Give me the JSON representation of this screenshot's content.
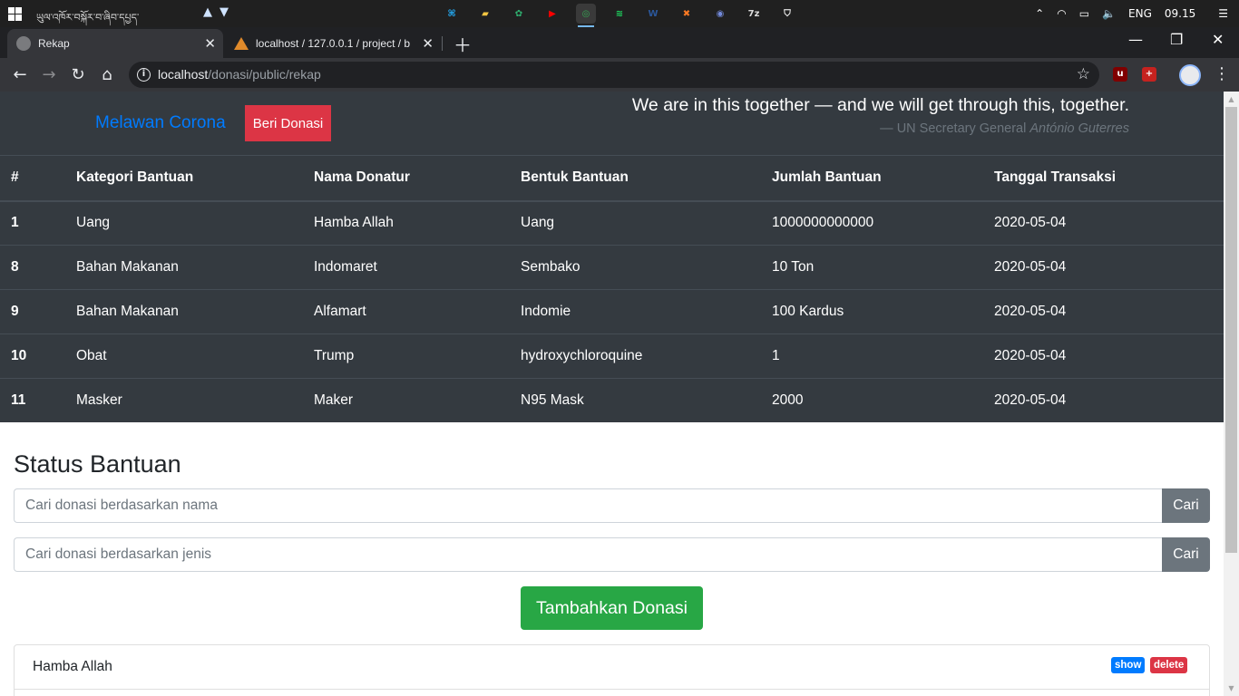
{
  "taskbar": {
    "task_name": "ཡུལ་འཁོར་བསྐོར་བ་ཞིབ་དཔྱད་",
    "apps": [
      {
        "name": "vscode-icon",
        "glyph": "⌘",
        "color": "#23a9f2",
        "active": false
      },
      {
        "name": "file-explorer-icon",
        "glyph": "▰",
        "color": "#f3c642",
        "active": false
      },
      {
        "name": "app-green-icon",
        "glyph": "✿",
        "color": "#2fb170",
        "active": false
      },
      {
        "name": "youtube-icon",
        "glyph": "▶",
        "color": "#ff0000",
        "active": false
      },
      {
        "name": "chrome-icon",
        "glyph": "◎",
        "color": "#34a853",
        "active": true
      },
      {
        "name": "spotify-icon",
        "glyph": "≋",
        "color": "#1ed760",
        "active": false
      },
      {
        "name": "word-icon",
        "glyph": "W",
        "color": "#2b579a",
        "active": false
      },
      {
        "name": "xampp-icon",
        "glyph": "✖",
        "color": "#fb7a24",
        "active": false
      },
      {
        "name": "discord-icon",
        "glyph": "◉",
        "color": "#7289da",
        "active": false
      },
      {
        "name": "7zip-icon",
        "glyph": "7z",
        "color": "#dddddd",
        "active": false
      },
      {
        "name": "shield-app-icon",
        "glyph": "⛉",
        "color": "#ffffff",
        "active": false
      }
    ],
    "tray": {
      "language": "ENG",
      "time": "09.15"
    }
  },
  "browser": {
    "tabs": [
      {
        "title": "Rekap",
        "active": true
      },
      {
        "title": "localhost / 127.0.0.1 / project / b",
        "active": false
      }
    ],
    "url_host": "localhost",
    "url_path": "/donasi/public/rekap"
  },
  "header": {
    "brand": "Melawan Corona",
    "donate_label": "Beri Donasi",
    "quote_text": "We are in this together — and we will get through this, together.",
    "quote_source_prefix": "— UN Secretary General ",
    "quote_source_name": "António Guterres"
  },
  "table": {
    "columns": [
      "#",
      "Kategori Bantuan",
      "Nama Donatur",
      "Bentuk Bantuan",
      "Jumlah Bantuan",
      "Tanggal Transaksi"
    ],
    "rows": [
      [
        "1",
        "Uang",
        "Hamba Allah",
        "Uang",
        "1000000000000",
        "2020-05-04"
      ],
      [
        "8",
        "Bahan Makanan",
        "Indomaret",
        "Sembako",
        "10 Ton",
        "2020-05-04"
      ],
      [
        "9",
        "Bahan Makanan",
        "Alfamart",
        "Indomie",
        "100 Kardus",
        "2020-05-04"
      ],
      [
        "10",
        "Obat",
        "Trump",
        "hydroxychloroquine",
        "1",
        "2020-05-04"
      ],
      [
        "11",
        "Masker",
        "Maker",
        "N95 Mask",
        "2000",
        "2020-05-04"
      ]
    ]
  },
  "status": {
    "title": "Status Bantuan",
    "search_name_placeholder": "Cari donasi berdasarkan nama",
    "search_type_placeholder": "Cari donasi berdasarkan jenis",
    "search_button": "Cari",
    "add_button": "Tambahkan Donasi",
    "items": [
      {
        "name": "Hamba Allah",
        "show_label": "show",
        "delete_label": "delete"
      }
    ]
  }
}
